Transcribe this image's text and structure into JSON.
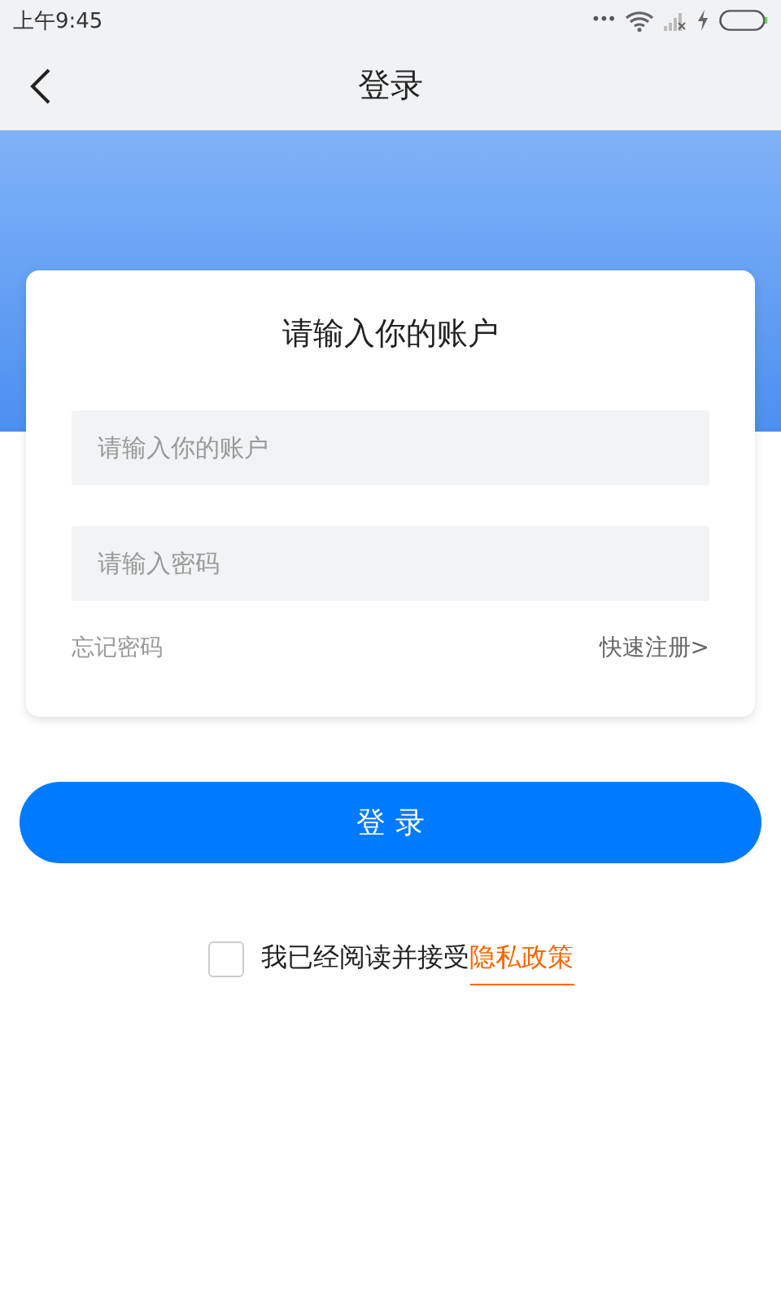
{
  "status_bar": {
    "time": "上午9:45",
    "dots": "•••"
  },
  "nav": {
    "title": "登录"
  },
  "card": {
    "title": "请输入你的账户",
    "fields": [
      {
        "placeholder": "请输入你的账户"
      },
      {
        "placeholder": "请输入密码"
      }
    ],
    "forgot_link": "忘记密码",
    "register_link": "快速注册>"
  },
  "login_button": "登 录",
  "agreement": {
    "checked": false,
    "text": "我已经阅读并接受",
    "link": "隐私政策"
  }
}
